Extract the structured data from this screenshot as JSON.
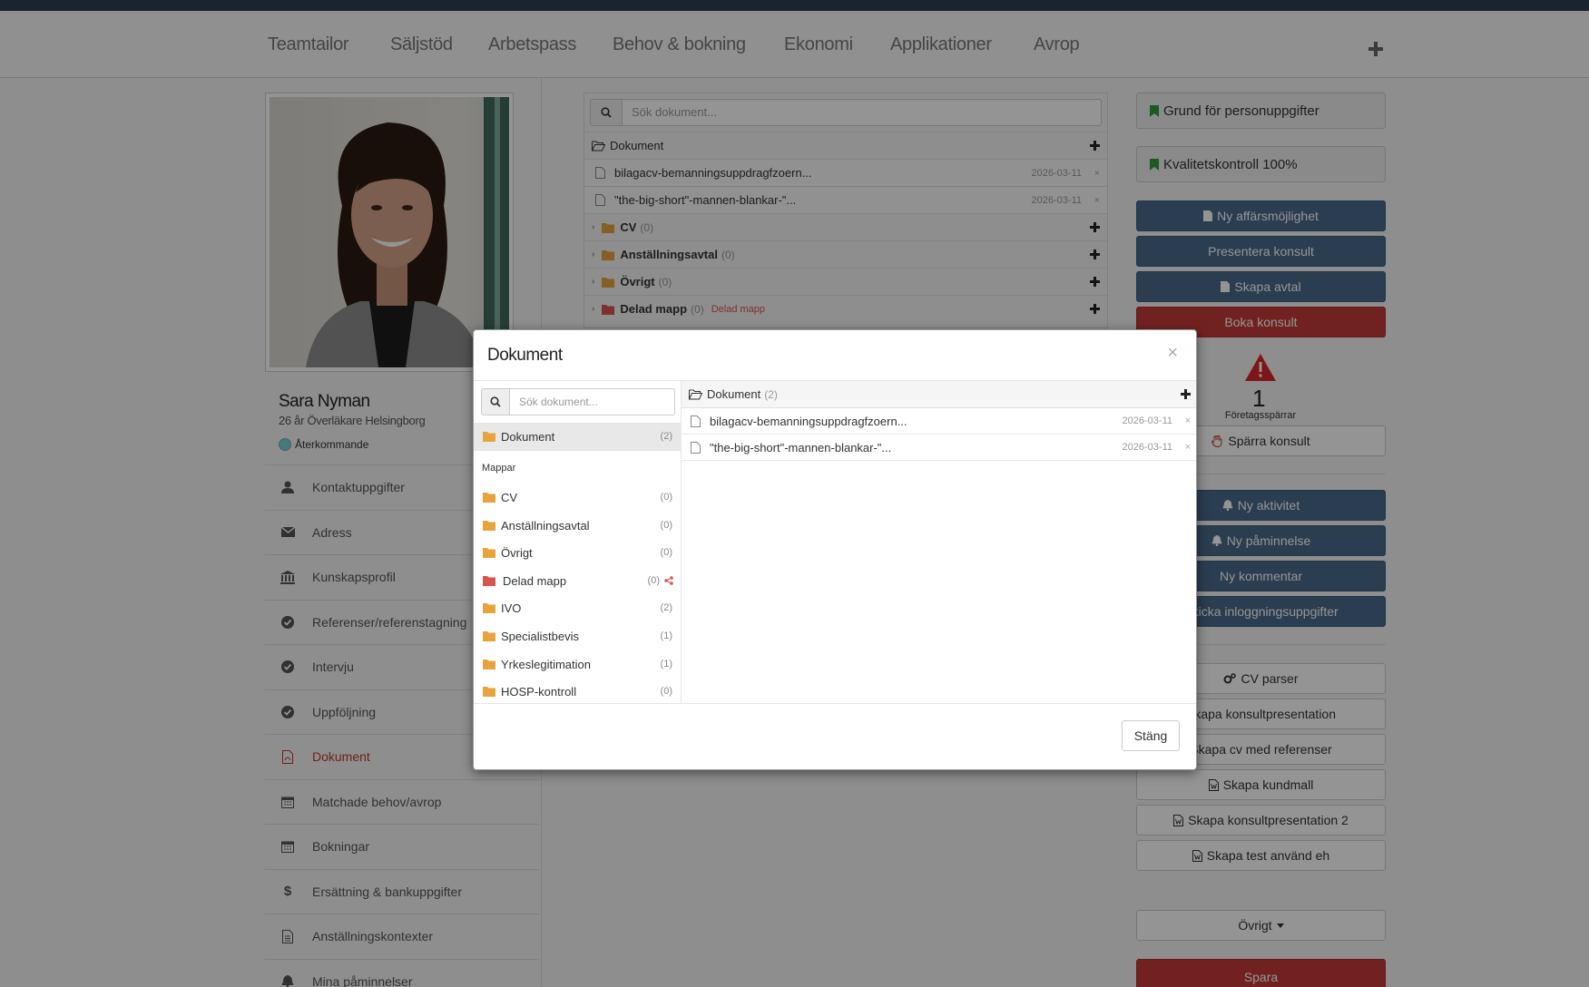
{
  "nav": {
    "items": [
      "Teamtailor",
      "Säljstöd",
      "Arbetspass",
      "Behov & bokning",
      "Ekonomi",
      "Applikationer",
      "Avrop"
    ]
  },
  "profile": {
    "name": "Sara Nyman",
    "subtitle": "26 år Överläkare Helsingborg",
    "status": "Återkommande"
  },
  "side_menu": [
    {
      "label": "Kontaktuppgifter",
      "icon": "user-icon"
    },
    {
      "label": "Adress",
      "icon": "envelope-icon"
    },
    {
      "label": "Kunskapsprofil",
      "icon": "bank-icon"
    },
    {
      "label": "Referenser/referenstagning",
      "icon": "check-circle-icon"
    },
    {
      "label": "Intervju",
      "icon": "check-circle-icon"
    },
    {
      "label": "Uppföljning",
      "icon": "check-circle-icon"
    },
    {
      "label": "Dokument",
      "icon": "file-pdf-icon"
    },
    {
      "label": "Matchade behov/avrop",
      "icon": "calendar-icon"
    },
    {
      "label": "Bokningar",
      "icon": "calendar-icon"
    },
    {
      "label": "Ersättning & bankuppgifter",
      "icon": "dollar-icon"
    },
    {
      "label": "Anställningskontexter",
      "icon": "file-icon"
    },
    {
      "label": "Mina påminnelser",
      "icon": "bell-icon"
    }
  ],
  "docpanel": {
    "search_placeholder": "Sök dokument...",
    "header": "Dokument",
    "files": [
      {
        "name": "bilagacv-bemanningsuppdragfzoern...",
        "date": "2026-03-11"
      },
      {
        "name": "\"the-big-short\"-mannen-blankar-\"...",
        "date": "2026-03-11"
      }
    ],
    "folders": [
      {
        "name": "CV",
        "count": "(0)"
      },
      {
        "name": "Anställningsavtal",
        "count": "(0)"
      },
      {
        "name": "Övrigt",
        "count": "(0)"
      },
      {
        "name": "Delad mapp",
        "count": "(0)",
        "tag": "Delad mapp"
      }
    ]
  },
  "right": {
    "grund": "Grund för personuppgifter",
    "kvalitet": "Kvalitetskontroll 100%",
    "ny_affar": "Ny affärsmöjlighet",
    "presentera": "Presentera konsult",
    "skapa_avtal": "Skapa avtal",
    "boka": "Boka konsult",
    "sparr_count": "1",
    "sparr_label": "Företagsspärrar",
    "sparra": "Spärra konsult",
    "ny_aktivitet": "Ny aktivitet",
    "ny_paminnelse": "Ny påminnelse",
    "ny_kommentar": "Ny kommentar",
    "skicka": "Skicka inloggningsuppgifter",
    "cv_parser": "CV parser",
    "skapa_kp": "Skapa konsultpresentation",
    "skapa_cvref": "Skapa cv med referenser",
    "skapa_kundmall": "Skapa kundmall",
    "skapa_kp2": "Skapa konsultpresentation 2",
    "skapa_test": "Skapa test använd eh",
    "ovrigt": "Övrigt",
    "spara": "Spara"
  },
  "modal": {
    "title": "Dokument",
    "search_placeholder": "Sök dokument...",
    "root": {
      "name": "Dokument",
      "count": "(2)"
    },
    "section_label": "Mappar",
    "folders": [
      {
        "name": "CV",
        "count": "(0)"
      },
      {
        "name": "Anställningsavtal",
        "count": "(0)"
      },
      {
        "name": "Övrigt",
        "count": "(0)"
      },
      {
        "name": "Delad mapp",
        "count": "(0)"
      },
      {
        "name": "IVO",
        "count": "(2)"
      },
      {
        "name": "Specialistbevis",
        "count": "(1)"
      },
      {
        "name": "Yrkeslegitimation",
        "count": "(1)"
      },
      {
        "name": "HOSP-kontroll",
        "count": "(0)"
      }
    ],
    "right_header": {
      "name": "Dokument",
      "count": "(2)"
    },
    "files": [
      {
        "name": "bilagacv-bemanningsuppdragfzoern...",
        "date": "2026-03-11"
      },
      {
        "name": "\"the-big-short\"-mannen-blankar-\"...",
        "date": "2026-03-11"
      }
    ],
    "close_label": "Stäng"
  },
  "colors": {
    "accent_blue": "#4a6a8a",
    "accent_red": "#c53a3a",
    "folder": "#e8a33d",
    "shared_folder": "#d9534f",
    "bookmark": "#2e9e3e"
  }
}
